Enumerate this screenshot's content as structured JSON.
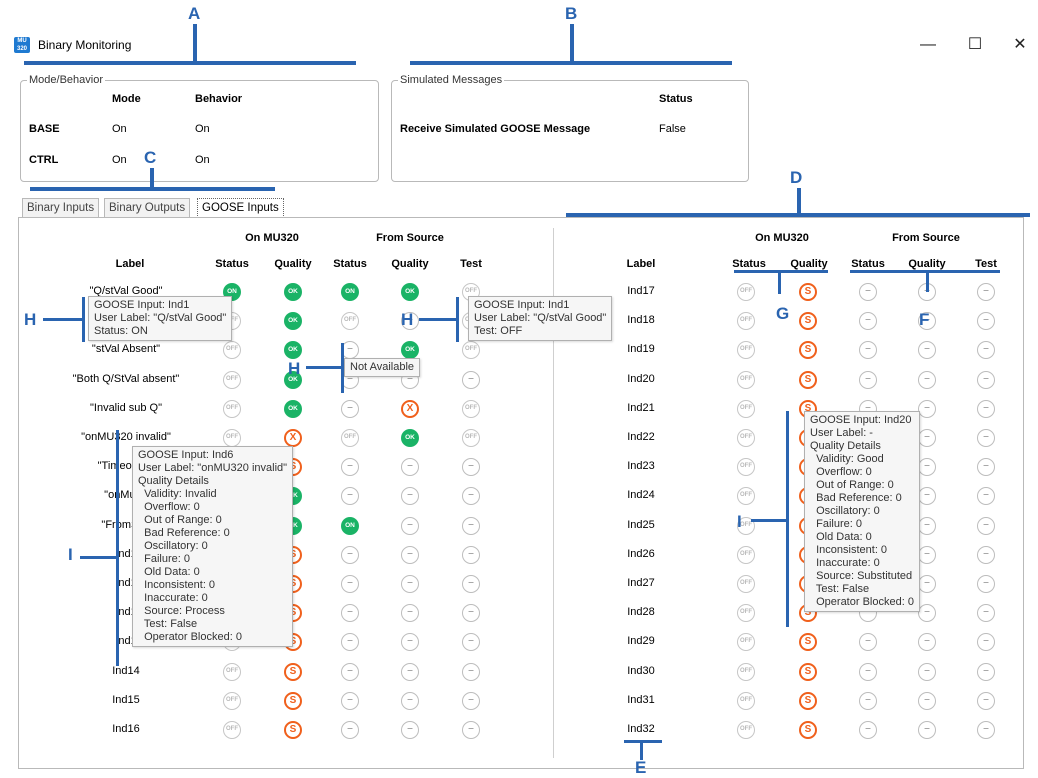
{
  "window": {
    "title": "Binary Monitoring",
    "icon": "MU\n320"
  },
  "controls": {
    "minimize": "—",
    "maximize": "☐",
    "close": "✕"
  },
  "mode_behavior": {
    "legend": "Mode/Behavior",
    "col_mode": "Mode",
    "col_behavior": "Behavior",
    "rows": [
      {
        "name": "BASE",
        "mode": "On",
        "behavior": "On"
      },
      {
        "name": "CTRL",
        "mode": "On",
        "behavior": "On"
      }
    ]
  },
  "simulated": {
    "legend": "Simulated Messages",
    "col_status": "Status",
    "row_label": "Receive Simulated GOOSE Message",
    "row_value": "False"
  },
  "tabs": [
    "Binary Inputs",
    "Binary Outputs",
    "GOOSE Inputs"
  ],
  "active_tab": 2,
  "table_headers": {
    "on_mu320": "On MU320",
    "from_source": "From Source",
    "label": "Label",
    "status": "Status",
    "quality": "Quality",
    "test": "Test"
  },
  "left_rows": [
    {
      "label": "\"Q/stVal Good\"",
      "s": "on",
      "q": "ok",
      "fs": "on",
      "fq": "ok",
      "t": "off"
    },
    {
      "label": "\"...\"",
      "s": "off",
      "q": "ok",
      "fs": "off",
      "fq": "na",
      "t": "off"
    },
    {
      "label": "\"stVal Absent\"",
      "s": "off",
      "q": "ok",
      "fs": "na",
      "fq": "ok",
      "t": "off"
    },
    {
      "label": "\"Both Q/StVal absent\"",
      "s": "off",
      "q": "ok",
      "fs": "na",
      "fq": "na",
      "t": "na"
    },
    {
      "label": "\"Invalid sub Q\"",
      "s": "off",
      "q": "ok",
      "fs": "na",
      "fq": "x",
      "t": "off"
    },
    {
      "label": "\"onMU320 invalid\"",
      "s": "off",
      "q": "x",
      "fs": "off",
      "fq": "ok",
      "t": "off"
    },
    {
      "label": "\"TimeoutSu",
      "s": "off",
      "q": "s",
      "fs": "na",
      "fq": "na",
      "t": "na"
    },
    {
      "label": "\"onMu32",
      "s": "off",
      "q": "ok",
      "fs": "na",
      "fq": "na",
      "t": "na"
    },
    {
      "label": "\"FromSou",
      "s": "off",
      "q": "ok",
      "fs": "on",
      "fq": "na",
      "t": "na"
    },
    {
      "label": "Ind1",
      "s": "off",
      "q": "s",
      "fs": "na",
      "fq": "na",
      "t": "na"
    },
    {
      "label": "Ind1",
      "s": "off",
      "q": "s",
      "fs": "na",
      "fq": "na",
      "t": "na"
    },
    {
      "label": "Ind1",
      "s": "off",
      "q": "s",
      "fs": "na",
      "fq": "na",
      "t": "na"
    },
    {
      "label": "Ind1",
      "s": "off",
      "q": "s",
      "fs": "na",
      "fq": "na",
      "t": "na"
    },
    {
      "label": "Ind14",
      "s": "off",
      "q": "s",
      "fs": "na",
      "fq": "na",
      "t": "na"
    },
    {
      "label": "Ind15",
      "s": "off",
      "q": "s",
      "fs": "na",
      "fq": "na",
      "t": "na"
    },
    {
      "label": "Ind16",
      "s": "off",
      "q": "s",
      "fs": "na",
      "fq": "na",
      "t": "na"
    }
  ],
  "right_rows": [
    {
      "label": "Ind17",
      "s": "off",
      "q": "s",
      "fs": "na",
      "fq": "na",
      "t": "na"
    },
    {
      "label": "Ind18",
      "s": "off",
      "q": "s",
      "fs": "na",
      "fq": "na",
      "t": "na"
    },
    {
      "label": "Ind19",
      "s": "off",
      "q": "s",
      "fs": "na",
      "fq": "na",
      "t": "na"
    },
    {
      "label": "Ind20",
      "s": "off",
      "q": "s",
      "fs": "na",
      "fq": "na",
      "t": "na"
    },
    {
      "label": "Ind21",
      "s": "off",
      "q": "s",
      "fs": "na",
      "fq": "na",
      "t": "na"
    },
    {
      "label": "Ind22",
      "s": "off",
      "q": "s",
      "fs": "na",
      "fq": "na",
      "t": "na"
    },
    {
      "label": "Ind23",
      "s": "off",
      "q": "s",
      "fs": "na",
      "fq": "na",
      "t": "na"
    },
    {
      "label": "Ind24",
      "s": "off",
      "q": "s",
      "fs": "na",
      "fq": "na",
      "t": "na"
    },
    {
      "label": "Ind25",
      "s": "off",
      "q": "s",
      "fs": "na",
      "fq": "na",
      "t": "na"
    },
    {
      "label": "Ind26",
      "s": "off",
      "q": "s",
      "fs": "na",
      "fq": "na",
      "t": "na"
    },
    {
      "label": "Ind27",
      "s": "off",
      "q": "s",
      "fs": "na",
      "fq": "na",
      "t": "na"
    },
    {
      "label": "Ind28",
      "s": "off",
      "q": "s",
      "fs": "na",
      "fq": "na",
      "t": "na"
    },
    {
      "label": "Ind29",
      "s": "off",
      "q": "s",
      "fs": "na",
      "fq": "na",
      "t": "na"
    },
    {
      "label": "Ind30",
      "s": "off",
      "q": "s",
      "fs": "na",
      "fq": "na",
      "t": "na"
    },
    {
      "label": "Ind31",
      "s": "off",
      "q": "s",
      "fs": "na",
      "fq": "na",
      "t": "na"
    },
    {
      "label": "Ind32",
      "s": "off",
      "q": "s",
      "fs": "na",
      "fq": "na",
      "t": "na"
    }
  ],
  "indicator_text": {
    "off": "OFF",
    "on": "ON",
    "ok": "OK",
    "s": "S",
    "x": "X",
    "na": "–"
  },
  "tooltips": {
    "ind1_left": [
      "GOOSE Input: Ind1",
      "User Label: \"Q/stVal Good\"",
      "Status: ON"
    ],
    "ind1_source": [
      "GOOSE Input: Ind1",
      "User Label: \"Q/stVal Good\"",
      "Test: OFF"
    ],
    "not_available": [
      "Not Available"
    ],
    "ind6": [
      "GOOSE Input: Ind6",
      "User Label: \"onMU320 invalid\"",
      "Quality Details",
      "  Validity: Invalid",
      "  Overflow: 0",
      "  Out of Range: 0",
      "  Bad Reference: 0",
      "  Oscillatory: 0",
      "  Failure: 0",
      "  Old Data: 0",
      "  Inconsistent: 0",
      "  Inaccurate: 0",
      "  Source: Process",
      "  Test: False",
      "  Operator Blocked: 0"
    ],
    "ind20": [
      "GOOSE Input: Ind20",
      "User Label: -",
      "Quality Details",
      "  Validity: Good",
      "  Overflow: 0",
      "  Out of Range: 0",
      "  Bad Reference: 0",
      "  Oscillatory: 0",
      "  Failure: 0",
      "  Old Data: 0",
      "  Inconsistent: 0",
      "  Inaccurate: 0",
      "  Source: Substituted",
      "  Test: False",
      "  Operator Blocked: 0"
    ]
  },
  "annotations": {
    "A": "A",
    "B": "B",
    "C": "C",
    "D": "D",
    "E": "E",
    "F": "F",
    "G": "G",
    "H": "H",
    "I": "I"
  },
  "colors": {
    "green": "#1ab366",
    "orange": "#f0601c",
    "annotation": "#2a64b0"
  }
}
